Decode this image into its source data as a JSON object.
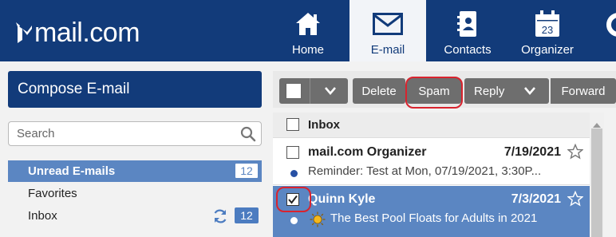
{
  "brand": {
    "logo_text": "mail.com"
  },
  "nav": [
    {
      "label": "Home",
      "icon": "home-icon"
    },
    {
      "label": "E-mail",
      "icon": "envelope-icon",
      "active": true
    },
    {
      "label": "Contacts",
      "icon": "contacts-book-icon"
    },
    {
      "label": "Organizer",
      "icon": "calendar-icon",
      "icon_text": "23"
    },
    {
      "label": "",
      "icon": "more-icon"
    }
  ],
  "sidebar": {
    "compose_label": "Compose E-mail",
    "search_placeholder": "Search",
    "folders": [
      {
        "label": "Unread E-mails",
        "count": "12",
        "selected": true
      },
      {
        "label": "Favorites"
      },
      {
        "label": "Inbox",
        "count": "12"
      }
    ]
  },
  "toolbar": {
    "delete_label": "Delete",
    "spam_label": "Spam",
    "reply_label": "Reply",
    "forward_label": "Forward"
  },
  "list": {
    "header": "Inbox",
    "messages": [
      {
        "sender": "mail.com Organizer",
        "date": "7/19/2021",
        "subject": "Reminder: Test at Mon, 07/19/2021, 3:30P...",
        "unread": true,
        "checked": false,
        "selected": false
      },
      {
        "sender": "Quinn Kyle",
        "date": "7/3/2021",
        "subject": "The Best Pool Floats for Adults in 2021",
        "unread": false,
        "checked": true,
        "selected": true
      }
    ]
  },
  "colors": {
    "header_bg": "#123b7a",
    "selected_row": "#5b86c2",
    "highlight_ring": "#d9232e",
    "toolbar_button": "#6e6e6e"
  }
}
